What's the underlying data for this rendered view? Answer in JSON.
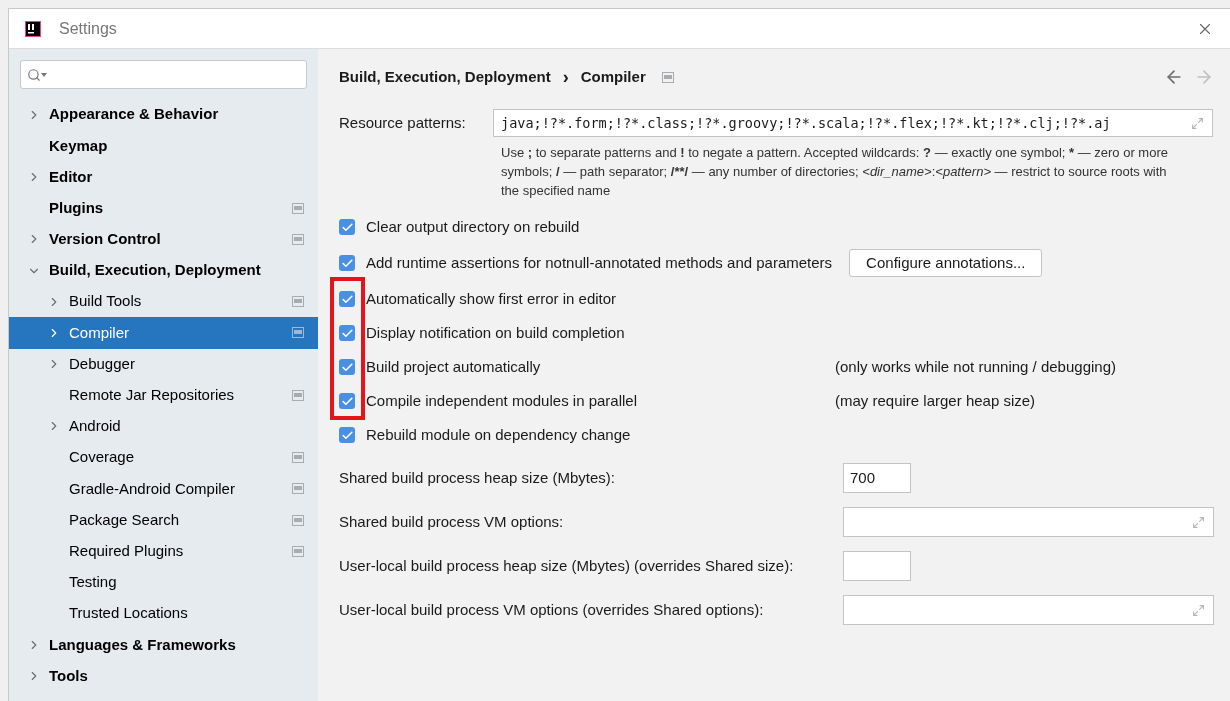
{
  "window": {
    "title": "Settings"
  },
  "sidebar": {
    "items": [
      {
        "label": "Appearance & Behavior",
        "expandable": true,
        "expanded": false,
        "project_level": false,
        "selected": false
      },
      {
        "label": "Keymap",
        "expandable": false,
        "expanded": false,
        "project_level": false,
        "selected": false
      },
      {
        "label": "Editor",
        "expandable": true,
        "expanded": false,
        "project_level": false,
        "selected": false
      },
      {
        "label": "Plugins",
        "expandable": false,
        "expanded": false,
        "project_level": true,
        "selected": false
      },
      {
        "label": "Version Control",
        "expandable": true,
        "expanded": false,
        "project_level": true,
        "selected": false
      },
      {
        "label": "Build, Execution, Deployment",
        "expandable": true,
        "expanded": true,
        "project_level": false,
        "selected": false,
        "children": [
          {
            "label": "Build Tools",
            "expandable": true,
            "expanded": false,
            "project_level": true,
            "selected": false
          },
          {
            "label": "Compiler",
            "expandable": true,
            "expanded": false,
            "project_level": true,
            "selected": true
          },
          {
            "label": "Debugger",
            "expandable": true,
            "expanded": false,
            "project_level": false,
            "selected": false
          },
          {
            "label": "Remote Jar Repositories",
            "expandable": false,
            "expanded": false,
            "project_level": true,
            "selected": false
          },
          {
            "label": "Android",
            "expandable": true,
            "expanded": false,
            "project_level": false,
            "selected": false
          },
          {
            "label": "Coverage",
            "expandable": false,
            "expanded": false,
            "project_level": true,
            "selected": false
          },
          {
            "label": "Gradle-Android Compiler",
            "expandable": false,
            "expanded": false,
            "project_level": true,
            "selected": false
          },
          {
            "label": "Package Search",
            "expandable": false,
            "expanded": false,
            "project_level": true,
            "selected": false
          },
          {
            "label": "Required Plugins",
            "expandable": false,
            "expanded": false,
            "project_level": true,
            "selected": false
          },
          {
            "label": "Testing",
            "expandable": false,
            "expanded": false,
            "project_level": false,
            "selected": false
          },
          {
            "label": "Trusted Locations",
            "expandable": false,
            "expanded": false,
            "project_level": false,
            "selected": false
          }
        ]
      },
      {
        "label": "Languages & Frameworks",
        "expandable": true,
        "expanded": false,
        "project_level": false,
        "selected": false
      },
      {
        "label": "Tools",
        "expandable": true,
        "expanded": false,
        "project_level": false,
        "selected": false
      }
    ]
  },
  "breadcrumb": {
    "items": [
      "Build, Execution, Deployment",
      "Compiler"
    ],
    "separator": "›",
    "project_level": true,
    "back_disabled": false,
    "forward_disabled": true
  },
  "resource_patterns": {
    "label": "Resource patterns:",
    "value": "java;!?*.form;!?*.class;!?*.groovy;!?*.scala;!?*.flex;!?*.kt;!?*.clj;!?*.aj",
    "help_text": [
      {
        "text": "Use ",
        "kind": "plain"
      },
      {
        "text": ";",
        "kind": "bold"
      },
      {
        "text": " to separate patterns and ",
        "kind": "plain"
      },
      {
        "text": "!",
        "kind": "bold"
      },
      {
        "text": " to negate a pattern. Accepted wildcards: ",
        "kind": "plain"
      },
      {
        "text": "?",
        "kind": "bold"
      },
      {
        "text": " — exactly one symbol; ",
        "kind": "plain"
      },
      {
        "text": "*",
        "kind": "bold"
      },
      {
        "text": " — zero or more symbols; ",
        "kind": "plain"
      },
      {
        "text": "/",
        "kind": "bold"
      },
      {
        "text": " — path separator; ",
        "kind": "plain"
      },
      {
        "text": "/**/",
        "kind": "bold"
      },
      {
        "text": " — any number of directories; ",
        "kind": "plain"
      },
      {
        "text": "<dir_name>",
        "kind": "italic"
      },
      {
        "text": ":",
        "kind": "plain"
      },
      {
        "text": "<pattern>",
        "kind": "italic"
      },
      {
        "text": " — restrict to source roots with the specified name",
        "kind": "plain"
      }
    ]
  },
  "options": [
    {
      "label": "Clear output directory on rebuild",
      "checked": true,
      "highlighted": false
    },
    {
      "label": "Add runtime assertions for notnull-annotated methods and parameters",
      "checked": true,
      "highlighted": false,
      "button": "Configure annotations..."
    },
    {
      "label": "Automatically show first error in editor",
      "checked": true,
      "highlighted": true
    },
    {
      "label": "Display notification on build completion",
      "checked": true,
      "highlighted": true
    },
    {
      "label": "Build project automatically",
      "checked": true,
      "highlighted": true,
      "note": "(only works while not running / debugging)"
    },
    {
      "label": "Compile independent modules in parallel",
      "checked": true,
      "highlighted": true,
      "note": "(may require larger heap size)"
    },
    {
      "label": "Rebuild module on dependency change",
      "checked": true,
      "highlighted": false
    }
  ],
  "fields": [
    {
      "label": "Shared build process heap size (Mbytes):",
      "kind": "short",
      "value": "700"
    },
    {
      "label": "Shared build process VM options:",
      "kind": "expandable"
    },
    {
      "label": "User-local build process heap size (Mbytes) (overrides Shared size):",
      "kind": "short"
    },
    {
      "label": "User-local build process VM options (overrides Shared options):",
      "kind": "expandable"
    }
  ]
}
